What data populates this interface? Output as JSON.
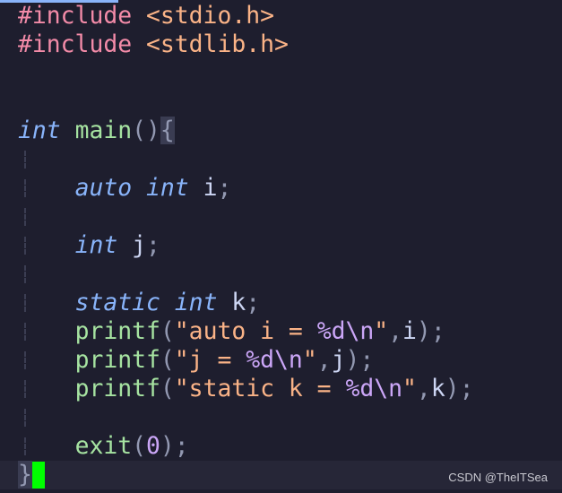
{
  "accent_color": "#89b4fa",
  "cursor_color": "#00ff00",
  "watermark": "CSDN @TheITSea",
  "lines": [
    {
      "guide": false,
      "tokens": [
        [
          "preproc",
          "#include"
        ],
        [
          "plain",
          " "
        ],
        [
          "header",
          "<stdio.h>"
        ]
      ]
    },
    {
      "guide": false,
      "tokens": [
        [
          "preproc",
          "#include"
        ],
        [
          "plain",
          " "
        ],
        [
          "header",
          "<stdlib.h>"
        ]
      ]
    },
    {
      "guide": false,
      "tokens": []
    },
    {
      "guide": false,
      "tokens": []
    },
    {
      "guide": false,
      "tokens": [
        [
          "type",
          "int"
        ],
        [
          "plain",
          " "
        ],
        [
          "func",
          "main"
        ],
        [
          "paren",
          "()"
        ],
        [
          "brace",
          "{"
        ]
      ]
    },
    {
      "guide": true,
      "tokens": []
    },
    {
      "guide": true,
      "tokens": [
        [
          "plain",
          "    "
        ],
        [
          "type",
          "auto"
        ],
        [
          "plain",
          " "
        ],
        [
          "type",
          "int"
        ],
        [
          "plain",
          " "
        ],
        [
          "ident",
          "i"
        ],
        [
          "punct",
          ";"
        ]
      ]
    },
    {
      "guide": true,
      "tokens": []
    },
    {
      "guide": true,
      "tokens": [
        [
          "plain",
          "    "
        ],
        [
          "type",
          "int"
        ],
        [
          "plain",
          " "
        ],
        [
          "ident",
          "j"
        ],
        [
          "punct",
          ";"
        ]
      ]
    },
    {
      "guide": true,
      "tokens": []
    },
    {
      "guide": true,
      "tokens": [
        [
          "plain",
          "    "
        ],
        [
          "type",
          "static"
        ],
        [
          "plain",
          " "
        ],
        [
          "type",
          "int"
        ],
        [
          "plain",
          " "
        ],
        [
          "ident",
          "k"
        ],
        [
          "punct",
          ";"
        ]
      ]
    },
    {
      "guide": true,
      "tokens": [
        [
          "plain",
          "    "
        ],
        [
          "func",
          "printf"
        ],
        [
          "paren",
          "("
        ],
        [
          "string",
          "\"auto i = "
        ],
        [
          "fmt",
          "%d\\n"
        ],
        [
          "string",
          "\""
        ],
        [
          "punct",
          ","
        ],
        [
          "ident",
          "i"
        ],
        [
          "paren",
          ")"
        ],
        [
          "punct",
          ";"
        ]
      ]
    },
    {
      "guide": true,
      "tokens": [
        [
          "plain",
          "    "
        ],
        [
          "func",
          "printf"
        ],
        [
          "paren",
          "("
        ],
        [
          "string",
          "\"j = "
        ],
        [
          "fmt",
          "%d\\n"
        ],
        [
          "string",
          "\""
        ],
        [
          "punct",
          ","
        ],
        [
          "ident",
          "j"
        ],
        [
          "paren",
          ")"
        ],
        [
          "punct",
          ";"
        ]
      ]
    },
    {
      "guide": true,
      "tokens": [
        [
          "plain",
          "    "
        ],
        [
          "func",
          "printf"
        ],
        [
          "paren",
          "("
        ],
        [
          "string",
          "\"static k = "
        ],
        [
          "fmt",
          "%d\\n"
        ],
        [
          "string",
          "\""
        ],
        [
          "punct",
          ","
        ],
        [
          "ident",
          "k"
        ],
        [
          "paren",
          ")"
        ],
        [
          "punct",
          ";"
        ]
      ]
    },
    {
      "guide": true,
      "tokens": []
    },
    {
      "guide": true,
      "tokens": [
        [
          "plain",
          "    "
        ],
        [
          "func",
          "exit"
        ],
        [
          "paren",
          "("
        ],
        [
          "num",
          "0"
        ],
        [
          "paren",
          ")"
        ],
        [
          "punct",
          ";"
        ]
      ]
    },
    {
      "guide": false,
      "current": true,
      "cursor": true,
      "tokens": [
        [
          "brace",
          "}"
        ]
      ]
    }
  ]
}
